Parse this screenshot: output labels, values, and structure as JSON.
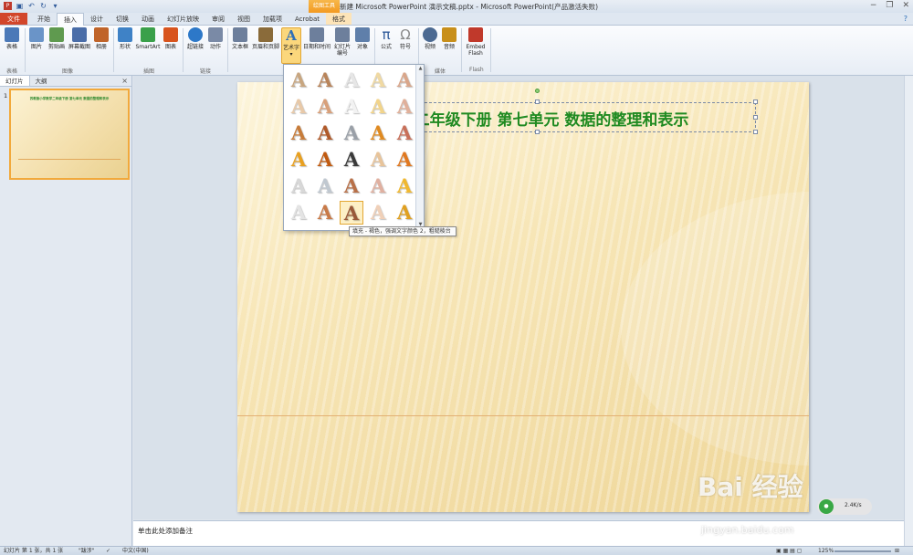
{
  "window": {
    "title": "新建 Microsoft PowerPoint 演示文稿.pptx - Microsoft PowerPoint(产品激活失败)",
    "context_tool": "绘图工具",
    "controls": [
      "−",
      "❐",
      "✕"
    ]
  },
  "tabs": [
    "文件",
    "开始",
    "插入",
    "设计",
    "切换",
    "动画",
    "幻灯片放映",
    "审阅",
    "视图",
    "加载项",
    "Acrobat",
    "格式"
  ],
  "active_tab": "插入",
  "ribbon": {
    "buttons": [
      {
        "label": "表格",
        "icon": "table-icon",
        "color": "#4b79b8"
      },
      {
        "label": "图片",
        "icon": "picture-icon",
        "color": "#6a94c8"
      },
      {
        "label": "剪贴画",
        "icon": "clipart-icon",
        "color": "#5f9a4f"
      },
      {
        "label": "屏幕截图",
        "icon": "screenshot-icon",
        "color": "#4a6da8"
      },
      {
        "label": "相册",
        "icon": "album-icon",
        "color": "#c0642a"
      },
      {
        "label": "形状",
        "icon": "shapes-icon",
        "color": "#3f82c6"
      },
      {
        "label": "SmartArt",
        "icon": "smartart-icon",
        "color": "#3aa04a"
      },
      {
        "label": "图表",
        "icon": "chart-icon",
        "color": "#d8541e"
      },
      {
        "label": "超链接",
        "icon": "hyperlink-icon",
        "color": "#2d78c8"
      },
      {
        "label": "动作",
        "icon": "action-icon",
        "color": "#7a8aa6"
      },
      {
        "label": "文本框",
        "icon": "textbox-icon",
        "color": "#6d7f9c"
      },
      {
        "label": "页眉和页脚",
        "icon": "header-footer-icon",
        "color": "#8a6b3a"
      },
      {
        "label": "艺术字",
        "icon": "wordart-icon",
        "color": "#2f6fb8"
      },
      {
        "label": "日期和时间",
        "icon": "datetime-icon",
        "color": "#6d7f9c"
      },
      {
        "label": "幻灯片 编号",
        "icon": "slide-number-icon",
        "color": "#6d7f9c"
      },
      {
        "label": "对象",
        "icon": "object-icon",
        "color": "#5f7faa"
      },
      {
        "label": "公式",
        "icon": "equation-icon",
        "color": "#2f5a9a"
      },
      {
        "label": "符号",
        "icon": "symbol-icon",
        "color": "#8a8a8a"
      },
      {
        "label": "视频",
        "icon": "video-icon",
        "color": "#4c6a92"
      },
      {
        "label": "音频",
        "icon": "audio-icon",
        "color": "#c88f1a"
      },
      {
        "label": "Embed Flash",
        "icon": "flash-icon",
        "color": "#c0392b"
      }
    ],
    "groups": [
      "表格",
      "图像",
      "插图",
      "链接",
      "媒体",
      "Flash"
    ]
  },
  "left_pane": {
    "tabs": [
      "幻灯片",
      "大纲"
    ],
    "close": "×",
    "slide_number": "1",
    "thumb_title": "苏教版小学数学二年级下册 第七单元 数据的整理和表示"
  },
  "slide": {
    "title": "二年级下册 第七单元 数据的整理和表示",
    "title_color": "#1f8a21"
  },
  "wordart_gallery": {
    "glyph": "A",
    "rows": [
      [
        "#c8a680",
        "#b8845a",
        "#e6e6e6",
        "#f0d9a2",
        "#d9a68a"
      ],
      [
        "#e8c9a8",
        "#d8a07a",
        "#f2f2f2",
        "#f2d48a",
        "#e0b09a"
      ],
      [
        "#c77c3a",
        "#b05a2a",
        "#9aa0a8",
        "#e08a20",
        "#c8705a"
      ],
      [
        "#e8a020",
        "#c05a10",
        "#3a3a3a",
        "#e8c49a",
        "#e07820"
      ],
      [
        "#d8d8d8",
        "#c0c8d0",
        "#b87048",
        "#e0b0a0",
        "#f0b830"
      ],
      [
        "#e4e4e4",
        "#c87a48",
        "#9a5a3a",
        "#f0d0b8",
        "#e0a020"
      ]
    ],
    "selected": "5-2",
    "scroll_up": "▲",
    "scroll_down": "▼"
  },
  "tooltip": "填充 - 褐色，强调文字颜色 2，粗糙棱台",
  "notes_placeholder": "单击此处添加备注",
  "status": {
    "slide_info": "幻灯片 第 1 张，共 1 张",
    "theme": "\"跋涉\"",
    "language": "中文(中国)",
    "zoom": "125%"
  },
  "watermark": {
    "brand": "Bai 经验",
    "url": "jingyan.baidu.com"
  },
  "speed_widget": {
    "value": "2.4K/s"
  }
}
